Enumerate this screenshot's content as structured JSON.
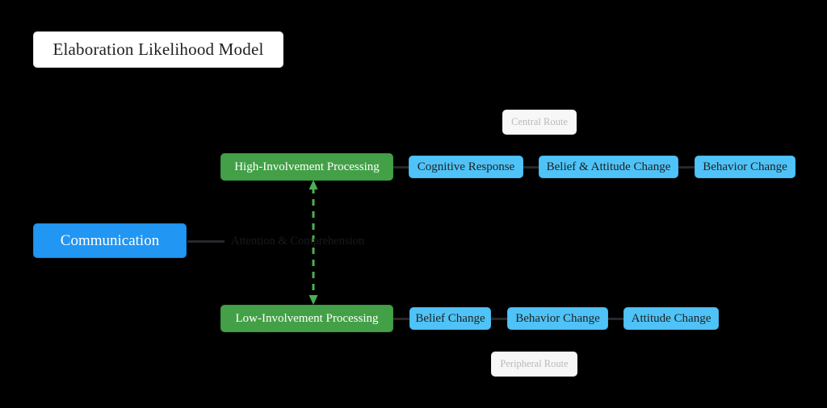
{
  "diagram": {
    "title": "Elaboration Likelihood Model",
    "background_color": "#000000",
    "nodes": {
      "source": {
        "label": "Communication",
        "color": "#2196F3",
        "text_color": "#FFFFFF"
      },
      "high_involvement": {
        "label": "High-Involvement Processing",
        "color": "#43A047",
        "text_color": "#FFFFFF"
      },
      "low_involvement": {
        "label": "Low-Involvement Processing",
        "color": "#43A047",
        "text_color": "#FFFFFF"
      },
      "central_route_label": {
        "label": "Central Route",
        "color": "#F7F7F7",
        "text_color": "#B9B9B9"
      },
      "peripheral_route_label": {
        "label": "Peripheral Route",
        "color": "#F7F7F7",
        "text_color": "#B9B9B9"
      },
      "central_outcomes": [
        {
          "label": "Cognitive Response",
          "color": "#4FC3F7"
        },
        {
          "label": "Belief & Attitude Change",
          "color": "#4FC3F7"
        },
        {
          "label": "Behavior Change",
          "color": "#4FC3F7"
        }
      ],
      "peripheral_outcomes": [
        {
          "label": "Belief Change",
          "color": "#4FC3F7"
        },
        {
          "label": "Behavior Change",
          "color": "#4FC3F7"
        },
        {
          "label": "Attitude Change",
          "color": "#4FC3F7"
        }
      ]
    },
    "edges": {
      "source_to_processing_label": "Attention & Comprehension",
      "connector_color": "#26282B",
      "elaboration_link_color": "#4CAF50",
      "elaboration_link_style": "dashed-bidirectional"
    }
  }
}
